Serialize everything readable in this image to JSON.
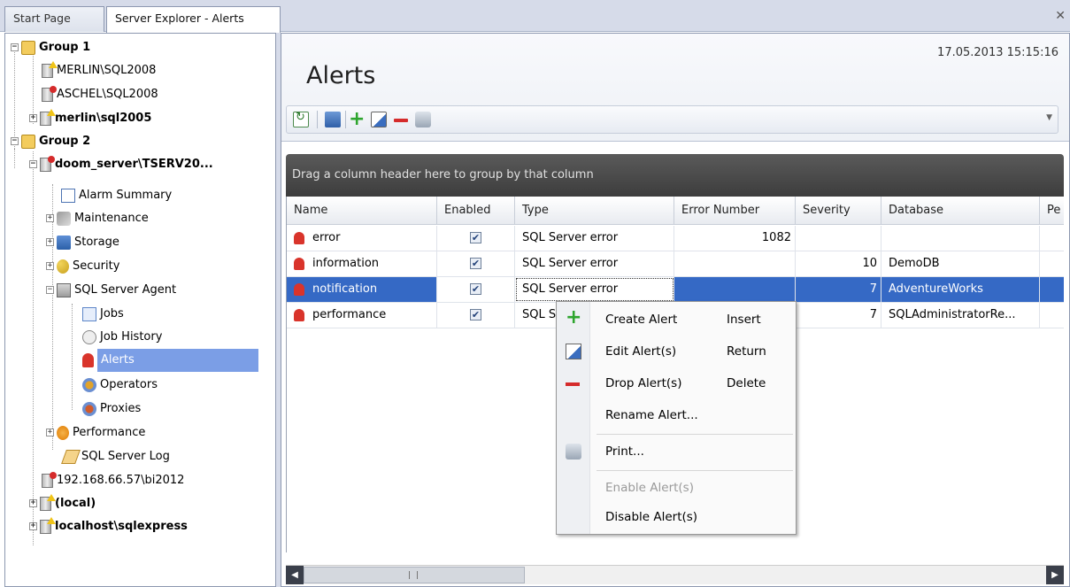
{
  "tabs": [
    {
      "label": "Start Page"
    },
    {
      "label": "Server Explorer - Alerts"
    }
  ],
  "tree": {
    "nodes": [
      {
        "label": "Group 1"
      },
      {
        "label": "MERLIN\\SQL2008"
      },
      {
        "label": "ASCHEL\\SQL2008"
      },
      {
        "label": "merlin\\sql2005"
      },
      {
        "label": "Group 2"
      },
      {
        "label": "doom_server\\TSERV20..."
      },
      {
        "label": "Alarm Summary"
      },
      {
        "label": "Maintenance"
      },
      {
        "label": "Storage"
      },
      {
        "label": "Security"
      },
      {
        "label": "SQL Server Agent"
      },
      {
        "label": "Jobs"
      },
      {
        "label": "Job History"
      },
      {
        "label": "Alerts"
      },
      {
        "label": "Operators"
      },
      {
        "label": "Proxies"
      },
      {
        "label": "Performance"
      },
      {
        "label": "SQL Server Log"
      },
      {
        "label": "192.168.66.57\\bi2012"
      },
      {
        "label": "(local)"
      },
      {
        "label": "localhost\\sqlexpress"
      }
    ]
  },
  "header": {
    "title": "Alerts",
    "timestamp": "17.05.2013 15:15:16"
  },
  "toolbar": {
    "icons": [
      "refresh-icon",
      "grid-icon",
      "add-icon",
      "edit-icon",
      "drop-icon",
      "print-icon"
    ]
  },
  "grid": {
    "group_panel_text": "Drag a column header here to group by that column",
    "columns": [
      "Name",
      "Enabled",
      "Type",
      "Error Number",
      "Severity",
      "Database",
      "Pe"
    ],
    "rows": [
      {
        "name": "error",
        "enabled": true,
        "type": "SQL Server error",
        "error_number": "1082",
        "severity": "",
        "database": ""
      },
      {
        "name": "information",
        "enabled": true,
        "type": "SQL Server error",
        "error_number": "",
        "severity": "10",
        "database": "DemoDB"
      },
      {
        "name": "notification",
        "enabled": true,
        "type": "SQL Server error",
        "error_number": "",
        "severity": "7",
        "database": "AdventureWorks"
      },
      {
        "name": "performance",
        "enabled": true,
        "type": "SQL S",
        "error_number": "",
        "severity": "7",
        "database": "SQLAdministratorRe..."
      }
    ],
    "selected_row": 2
  },
  "context_menu": {
    "items": [
      {
        "label": "Create Alert",
        "shortcut": "Insert",
        "enabled": true
      },
      {
        "label": "Edit Alert(s)",
        "shortcut": "Return",
        "enabled": true
      },
      {
        "label": "Drop Alert(s)",
        "shortcut": "Delete",
        "enabled": true
      },
      {
        "label": "Rename Alert...",
        "shortcut": "",
        "enabled": true
      },
      {
        "label": "Print...",
        "shortcut": "",
        "enabled": true
      },
      {
        "label": "Enable Alert(s)",
        "shortcut": "",
        "enabled": false
      },
      {
        "label": "Disable Alert(s)",
        "shortcut": "",
        "enabled": true
      }
    ]
  },
  "colors": {
    "selection": "#3569c5",
    "tree_selection": "#7b9ee6",
    "group_panel": "#4a4a4a",
    "alert_icon": "#d9342b"
  }
}
